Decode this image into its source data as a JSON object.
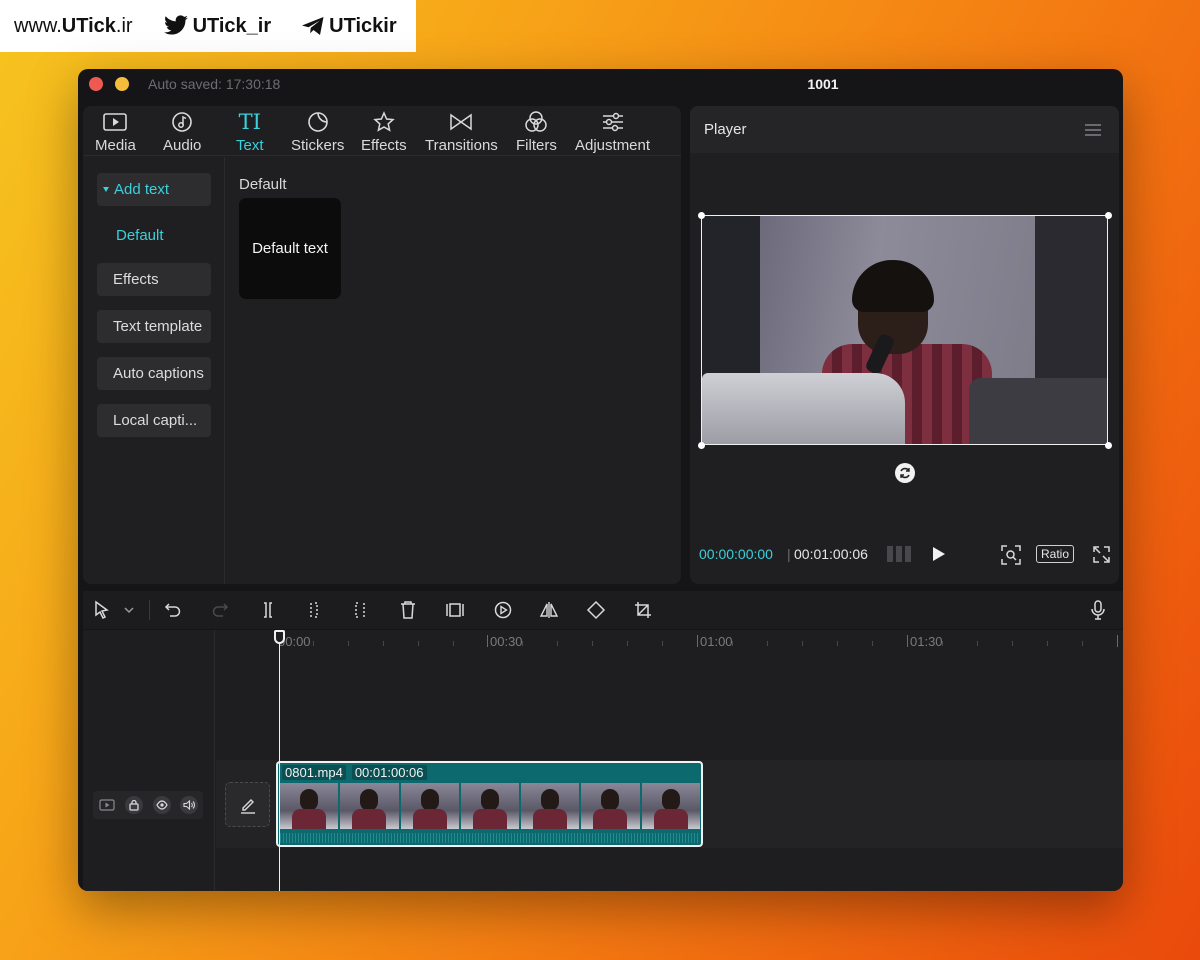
{
  "watermark": {
    "site_prefix": "www.",
    "site_brand": "UTick",
    "site_suffix": ".ir",
    "twitter_handle": "UTick_ir",
    "telegram_handle": "UTickir"
  },
  "window": {
    "autosave": "Auto saved: 17:30:18",
    "project_title": "1001"
  },
  "tabs": [
    {
      "label": "Media",
      "icon": "media-icon"
    },
    {
      "label": "Audio",
      "icon": "audio-icon"
    },
    {
      "label": "Text",
      "icon": "text-icon",
      "glyph": "TI"
    },
    {
      "label": "Stickers",
      "icon": "stickers-icon"
    },
    {
      "label": "Effects",
      "icon": "effects-icon"
    },
    {
      "label": "Transitions",
      "icon": "transitions-icon"
    },
    {
      "label": "Filters",
      "icon": "filters-icon"
    },
    {
      "label": "Adjustment",
      "icon": "adjustment-icon"
    }
  ],
  "sidebar": {
    "items": [
      {
        "label": "Add text"
      },
      {
        "label": "Default"
      },
      {
        "label": "Effects"
      },
      {
        "label": "Text template"
      },
      {
        "label": "Auto captions"
      },
      {
        "label": "Local capti..."
      }
    ]
  },
  "content": {
    "heading": "Default",
    "card_label": "Default text"
  },
  "player": {
    "title": "Player",
    "current_time": "00:00:00:00",
    "separator": "|",
    "total_time": "00:01:00:06",
    "ratio_label": "Ratio"
  },
  "timeline": {
    "ruler": [
      "00:00",
      "00:30",
      "01:00",
      "01:30"
    ],
    "clip": {
      "filename": "0801.mp4",
      "duration": "00:01:00:06"
    }
  },
  "colors": {
    "accent": "#3ad0dc",
    "clip": "#0c6a6e",
    "close": "#ee5a52",
    "minimize": "#f4be3c"
  }
}
